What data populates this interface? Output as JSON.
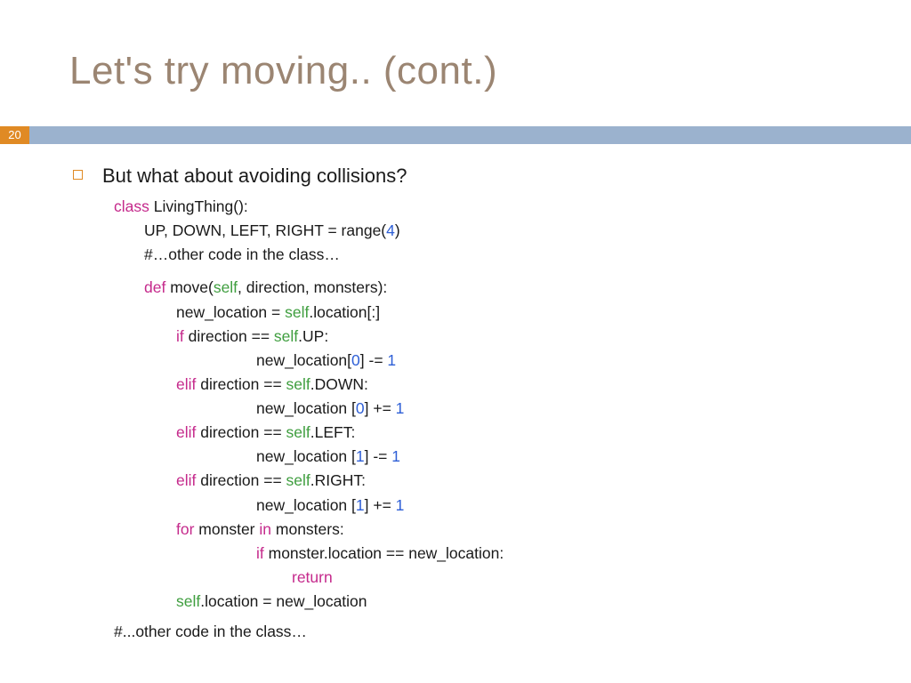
{
  "slide": {
    "number": "20",
    "title": "Let's try moving.. (cont.)",
    "bullet": "But what about avoiding collisions?",
    "footer": "#...other code in the class…"
  },
  "code": {
    "l0a": "class",
    "l0b": " LivingThing():",
    "l1a": "UP, DOWN, LEFT, RIGHT = range(",
    "l1n": "4",
    "l1b": ")",
    "l2": "#…other code in the class…",
    "l3a": "def",
    "l3b": " move(",
    "l3s": "self",
    "l3c": ", direction, monsters):",
    "l4a": "new_location = ",
    "l4s": "self",
    "l4b": ".location[:]",
    "l5a": "if",
    "l5b": " direction == ",
    "l5s": "self",
    "l5c": ".UP:",
    "l6a": "new_location[",
    "l6n": "0",
    "l6b": "] -= ",
    "l6m": "1",
    "l7a": "elif",
    "l7b": " direction == ",
    "l7s": "self",
    "l7c": ".DOWN:",
    "l8a": "new_location [",
    "l8n": "0",
    "l8b": "] += ",
    "l8m": "1",
    "l9a": "elif",
    "l9b": " direction == ",
    "l9s": "self",
    "l9c": ".LEFT:",
    "l10a": "new_location [",
    "l10n": "1",
    "l10b": "] -= ",
    "l10m": "1",
    "l11a": "elif",
    "l11b": " direction == ",
    "l11s": "self",
    "l11c": ".RIGHT:",
    "l12a": "new_location [",
    "l12n": "1",
    "l12b": "] += ",
    "l12m": "1",
    "l13a": "for",
    "l13b": " monster ",
    "l13c": "in",
    "l13d": " monsters:",
    "l14a": "if",
    "l14b": " monster.location == new_location:",
    "l15": "return",
    "l16s": "self",
    "l16a": ".location = new_location"
  }
}
